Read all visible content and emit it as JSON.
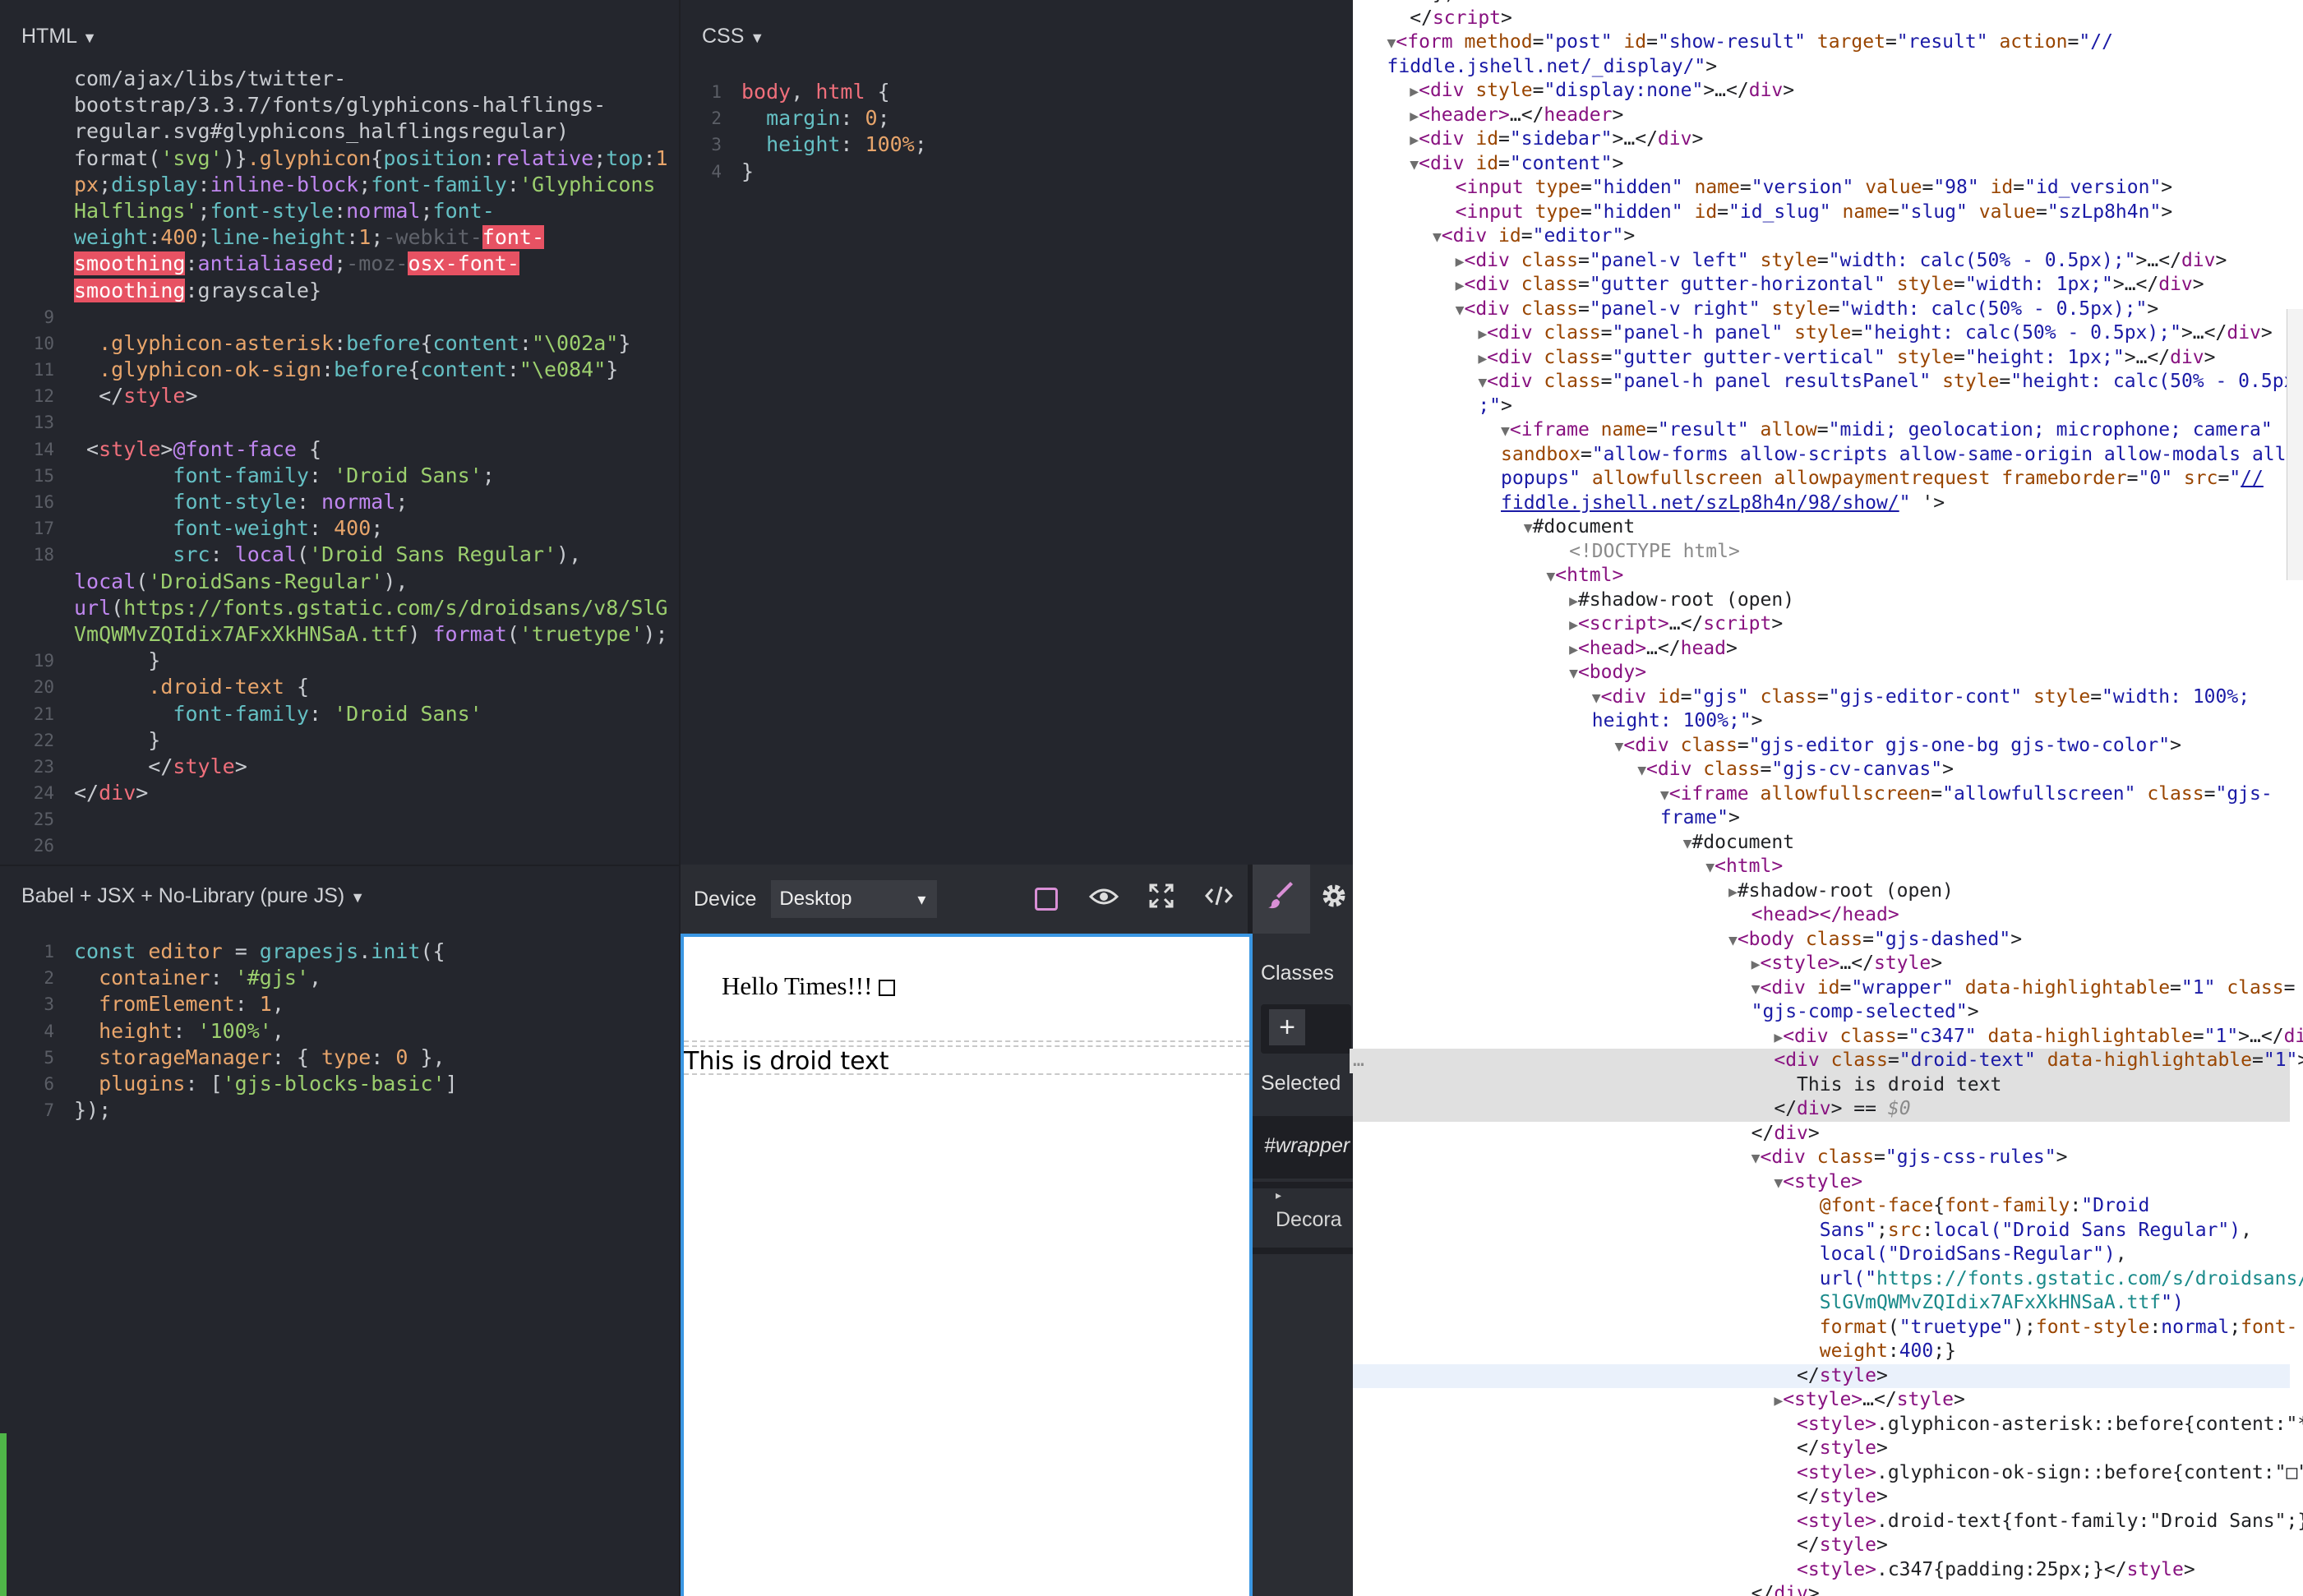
{
  "html_panel": {
    "title": "HTML",
    "caret": "▼"
  },
  "css_panel": {
    "title": "CSS",
    "caret": "▼"
  },
  "js_panel": {
    "title": "Babel + JSX + No-Library (pure JS)",
    "caret": "▼"
  },
  "toolbar": {
    "device_label": "Device",
    "device_value": "Desktop",
    "caret": "▾"
  },
  "canvas": {
    "hello": "Hello Times!!!",
    "droid": "This is droid text"
  },
  "style_manager": {
    "classes": "Classes",
    "add": "+",
    "selected": "Selected",
    "selected_value": "#wrapper",
    "decorations": "Decora"
  },
  "colors": {
    "accent": "#3b97e3",
    "highlight": "#e75263",
    "panel": "#24262d"
  }
}
